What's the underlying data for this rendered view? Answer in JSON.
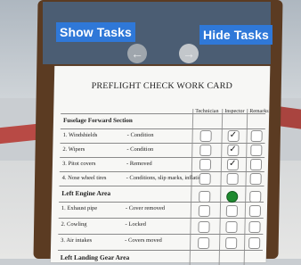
{
  "toolbar": {
    "show_label": "Show Tasks",
    "hide_label": "Hide Tasks",
    "prev_icon": "arrow-left-icon",
    "next_icon": "arrow-right-icon"
  },
  "card": {
    "title": "PREFLIGHT CHECK WORK CARD",
    "columns": [
      "Technician",
      "Inspector",
      "Remarks"
    ],
    "sections": [
      {
        "name": "Fuselage Forward Section",
        "items": [
          {
            "item": "1. Windshields",
            "check": "- Condition",
            "inspector_checked": true
          },
          {
            "item": "2. Wipers",
            "check": "- Condition",
            "inspector_checked": true
          },
          {
            "item": "3. Pitot covers",
            "check": "- Removed",
            "inspector_checked": true
          },
          {
            "item": "4. Nose wheel tires",
            "check": "- Conditions, slip marks, inflation",
            "inspector_checked": false
          }
        ]
      },
      {
        "name": "Left Engine Area",
        "items": [
          {
            "item": "1. Exhaust pipe",
            "check": "- Cover removed"
          },
          {
            "item": "2. Cowling",
            "check": "- Locked"
          },
          {
            "item": "3. Air intakes",
            "check": "- Covers moved"
          }
        ]
      },
      {
        "name": "Left Landing Gear Area",
        "items": []
      }
    ],
    "active_indicator_color": "#1e8a2f"
  }
}
